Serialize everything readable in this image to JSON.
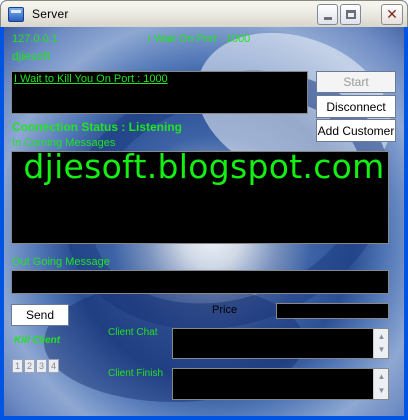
{
  "window": {
    "title": "Server",
    "controls": {
      "minimize": "minimize",
      "maximize": "maximize",
      "close": "✕"
    }
  },
  "header": {
    "ip": "127.0.0.1",
    "port_status": "I Wait On Port : 1000",
    "server_name": "djiesoft"
  },
  "log": {
    "lines": [
      "I Wait to Kill You On Port : 1000"
    ]
  },
  "connection_status": "Connection Status : Listening",
  "labels": {
    "incoming": "In Coming Messages",
    "outgoing": "Out Going Message",
    "price": "Price",
    "client_chat": "Client Chat",
    "client_finish": "Client Finish"
  },
  "buttons": {
    "start": "Start",
    "disconnect": "Disconnect",
    "add_customer": "Add Customer",
    "send": "Send",
    "kill_client": "Kill Client"
  },
  "client_numbers": [
    "1",
    "2",
    "3",
    "4"
  ],
  "watermark": "djiesoft.blogspot.com",
  "inputs": {
    "outgoing_message": "",
    "price": ""
  },
  "colors": {
    "text_accent": "#21e321",
    "titlebar": "#ecebe4",
    "panel": "#000000"
  }
}
